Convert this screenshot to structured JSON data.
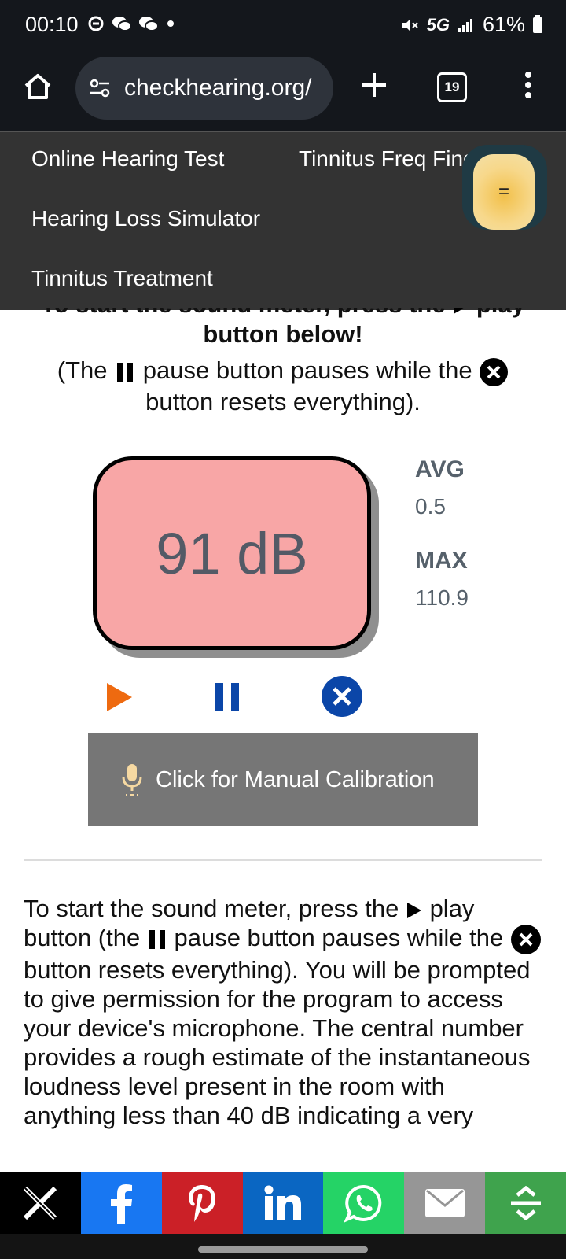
{
  "status_bar": {
    "time": "00:10",
    "network": "5G",
    "battery": "61%",
    "icons": [
      "sync-icon",
      "wechat-icon",
      "wechat-icon",
      "dot-icon",
      "mute-icon",
      "signal-icon",
      "battery-icon"
    ]
  },
  "browser": {
    "url": "checkhearing.org/",
    "tab_count": "19",
    "icons": [
      "home-icon",
      "site-settings-icon",
      "new-tab-icon",
      "more-icon"
    ]
  },
  "nav_menu": {
    "items": [
      "Online Hearing Test",
      "Tinnitus Freq Find",
      "Hearing Loss Simulator",
      "Tinnitus Treatment"
    ],
    "toggle_label": "="
  },
  "intro": {
    "line1": "To start the sound meter, press the",
    "line1_end": "play",
    "line2": "button below!",
    "line3a": "(The",
    "line3b": "pause button pauses while the",
    "line4": "button resets everything)."
  },
  "meter": {
    "value": "91 dB",
    "avg_label": "AVG",
    "avg_value": "0.5",
    "max_label": "MAX",
    "max_value": "110.9"
  },
  "calibration": {
    "label": "Click for Manual Calibration"
  },
  "body": {
    "p1a": "To start the sound meter, press the",
    "p1b": "play button (the",
    "p1c": "pause button pauses while the",
    "p1d": "button resets everything). You will be prompted to give permission for the program to access your device's microphone. The central number provides a rough estimate of the instantaneous loudness level present in the room with anything less than 40 dB indicating a very"
  },
  "share_bar": {
    "colors": {
      "x": "#000000",
      "facebook": "#1877f2",
      "pinterest": "#cb2027",
      "linkedin": "#0a66c2",
      "whatsapp": "#25d366",
      "email": "#969696",
      "more": "#3fa34d"
    }
  }
}
